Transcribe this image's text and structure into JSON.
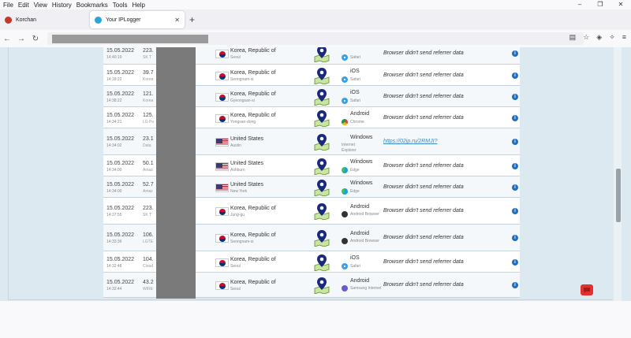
{
  "menu": [
    "File",
    "Edit",
    "View",
    "History",
    "Bookmarks",
    "Tools",
    "Help"
  ],
  "window_controls": [
    "–",
    "❐",
    "✕"
  ],
  "tabs": [
    {
      "label": "Korchan",
      "active": false,
      "favicon_color": "#c0392b"
    },
    {
      "label": "Your IPLogger",
      "active": true,
      "favicon_color": "#2aa6d9"
    }
  ],
  "new_tab_label": "+",
  "nav": {
    "back": "←",
    "forward": "→",
    "reload": "↻"
  },
  "nav_right_icons": [
    "reader-icon",
    "star-icon",
    "shield-icon",
    "extensions-icon",
    "menu-icon"
  ],
  "rows": [
    {
      "date": "15.05.2022",
      "time": "14:40:19",
      "ip": "223.",
      "isp": "SK T",
      "flag": "kr",
      "country": "Korea, Republic of",
      "city": "Seoul",
      "os": "",
      "os_icon": "apple",
      "browser": "Safari",
      "browser_icon": "safari",
      "referrer": "Browser didn't send referrer data",
      "link": false
    },
    {
      "date": "15.05.2022",
      "time": "14:18:22",
      "ip": "39.7",
      "isp": "Korea",
      "flag": "kr",
      "country": "Korea, Republic of",
      "city": "Seongnam-si",
      "os": "iOS",
      "os_icon": "apple",
      "browser": "Safari",
      "browser_icon": "safari",
      "referrer": "Browser didn't send referrer data",
      "link": false
    },
    {
      "date": "15.05.2022",
      "time": "14:38:22",
      "ip": "121.",
      "isp": "Korea",
      "flag": "kr",
      "country": "Korea, Republic of",
      "city": "Gyeongsan-si",
      "os": "iOS",
      "os_icon": "apple",
      "browser": "Safari",
      "browser_icon": "safari",
      "referrer": "Browser didn't send referrer data",
      "link": false
    },
    {
      "date": "15.05.2022",
      "time": "14:34:21",
      "ip": "125.",
      "isp": "LG Po",
      "flag": "kr",
      "country": "Korea, Republic of",
      "city": "Yongsan-dong",
      "os": "Android",
      "os_icon": "android",
      "browser": "Chrome",
      "browser_icon": "chrome",
      "referrer": "Browser didn't send referrer data",
      "link": false
    },
    {
      "date": "15.05.2022",
      "time": "14:34:02",
      "ip": "23.1",
      "isp": "Data",
      "flag": "us",
      "country": "United States",
      "city": "Austin",
      "os": "Windows",
      "os_icon": "windows",
      "browser": "Internet Explorer",
      "browser_icon": "",
      "referrer": "https://02ip.ru/2RMJI?",
      "link": true
    },
    {
      "date": "15.05.2022",
      "time": "14:34:00",
      "ip": "50.1",
      "isp": "Amaz",
      "flag": "us",
      "country": "United States",
      "city": "Ashburn",
      "os": "Windows",
      "os_icon": "windows",
      "browser": "Edge",
      "browser_icon": "edge",
      "referrer": "Browser didn't send referrer data",
      "link": false
    },
    {
      "date": "15.05.2022",
      "time": "14:34:00",
      "ip": "52.7",
      "isp": "Amaz",
      "flag": "us",
      "country": "United States",
      "city": "New York",
      "os": "Windows",
      "os_icon": "windows",
      "browser": "Edge",
      "browser_icon": "edge",
      "referrer": "Browser didn't send referrer data",
      "link": false
    },
    {
      "date": "15.05.2022",
      "time": "14:37:55",
      "ip": "223.",
      "isp": "SK T",
      "flag": "kr",
      "country": "Korea, Republic of",
      "city": "Jung-gu",
      "os": "Android",
      "os_icon": "android",
      "browser": "Android Browser",
      "browser_icon": "android-browser",
      "referrer": "Browser didn't send referrer data",
      "link": false
    },
    {
      "date": "15.05.2022",
      "time": "14:33:36",
      "ip": "106.",
      "isp": "LGTE",
      "flag": "kr",
      "country": "Korea, Republic of",
      "city": "Seongnam-si",
      "os": "Android",
      "os_icon": "android",
      "browser": "Android Browser",
      "browser_icon": "android-browser",
      "referrer": "Browser didn't send referrer data",
      "link": false
    },
    {
      "date": "15.05.2022",
      "time": "14:32:48",
      "ip": "104.",
      "isp": "Cloud",
      "flag": "kr",
      "country": "Korea, Republic of",
      "city": "Seoul",
      "os": "iOS",
      "os_icon": "apple",
      "browser": "Safari",
      "browser_icon": "safari",
      "referrer": "Browser didn't send referrer data",
      "link": false
    },
    {
      "date": "15.05.2022",
      "time": "14:32:44",
      "ip": "43.2",
      "isp": "WIRE",
      "flag": "kr",
      "country": "Korea, Republic of",
      "city": "Seoul",
      "os": "Android",
      "os_icon": "android",
      "browser": "Samsung Internet",
      "browser_icon": "samsung",
      "referrer": "Browser didn't send referrer data",
      "link": false
    }
  ],
  "info_glyph": "i",
  "colors": {
    "info": "#1f6fc4",
    "link": "#3b8bc4",
    "pin": "#1a2a7a",
    "map": "#8bc34a",
    "chat": "#e2302e"
  }
}
